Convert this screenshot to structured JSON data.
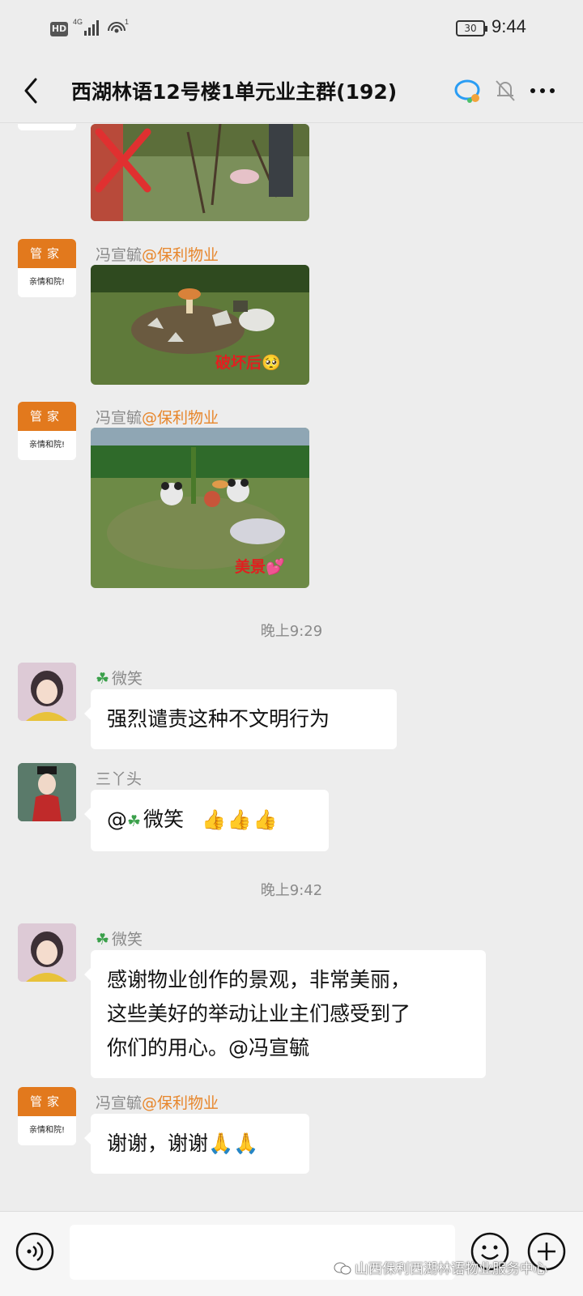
{
  "status_bar": {
    "network_badge": "HD",
    "signal_label": "4G",
    "hotspot_count": "1",
    "battery": "30",
    "time": "9:44"
  },
  "header": {
    "title": "西湖林语12号楼1单元业主群(192)"
  },
  "messages": {
    "m1": {
      "name": "冯宣毓",
      "org": "@保利物业",
      "caption": "破坏后🥺"
    },
    "m2": {
      "name": "冯宣毓",
      "org": "@保利物业",
      "caption": "美景💕"
    },
    "ts1": "晚上9:29",
    "m3": {
      "name": "微笑",
      "text": "强烈谴责这种不文明行为"
    },
    "m4": {
      "name": "三丫头",
      "mention": "@",
      "mention_name": "微笑",
      "thumbs": "👍👍👍"
    },
    "ts2": "晚上9:42",
    "m5": {
      "name": "微笑",
      "line1": "感谢物业创作的景观，非常美丽，",
      "line2": "这些美好的举动让业主们感受到了",
      "line3": "你们的用心。@冯宣毓"
    },
    "m6": {
      "name": "冯宣毓",
      "org": "@保利物业",
      "text": "谢谢，谢谢🙏🙏"
    }
  },
  "avatar_guanjia": {
    "top": "管家",
    "bottom": "亲情和院!"
  },
  "watermark": "山西保利西湖林语物业服务中心",
  "colors": {
    "background": "#ededed",
    "org_text": "#e7862b",
    "caption_red": "#e02020",
    "avatar_orange": "#e2791d"
  }
}
